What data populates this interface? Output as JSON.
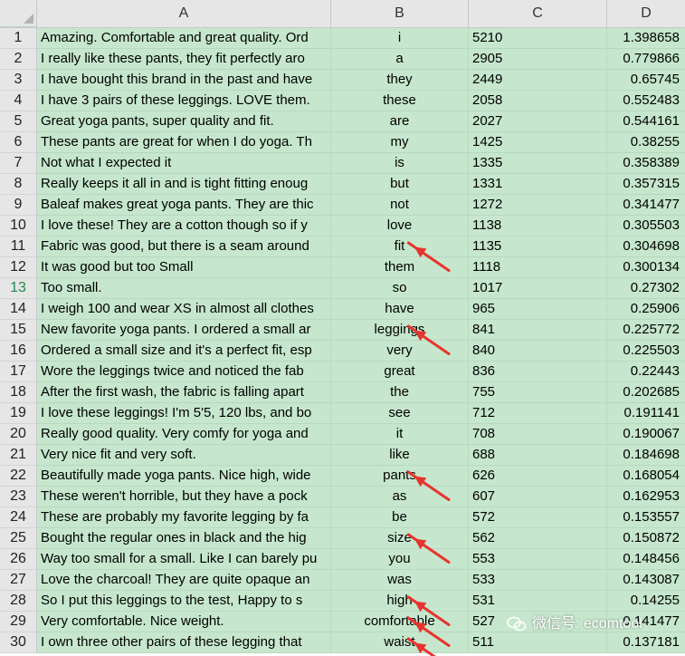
{
  "columns": [
    "A",
    "B",
    "C",
    "D"
  ],
  "selected_row": 13,
  "rows": [
    {
      "n": "1",
      "a": "Amazing. Comfortable and great quality. Ord",
      "b": "i",
      "c": "5210",
      "d": "1.398658"
    },
    {
      "n": "2",
      "a": "I really like these pants, they fit perfectly aro",
      "b": "a",
      "c": "2905",
      "d": "0.779866"
    },
    {
      "n": "3",
      "a": "I have bought this brand in the past and have",
      "b": "they",
      "c": "2449",
      "d": "0.65745"
    },
    {
      "n": "4",
      "a": "I have 3 pairs of these leggings. LOVE them.",
      "b": "these",
      "c": "2058",
      "d": "0.552483"
    },
    {
      "n": "5",
      "a": "Great yoga pants, super quality and fit.",
      "b": "are",
      "c": "2027",
      "d": "0.544161"
    },
    {
      "n": "6",
      "a": "These pants are great for when I do yoga. Th",
      "b": "my",
      "c": "1425",
      "d": "0.38255"
    },
    {
      "n": "7",
      "a": "Not what I expected it",
      "b": "is",
      "c": "1335",
      "d": "0.358389"
    },
    {
      "n": "8",
      "a": "Really keeps it all in and is tight fitting enoug",
      "b": "but",
      "c": "1331",
      "d": "0.357315"
    },
    {
      "n": "9",
      "a": "Baleaf makes great yoga pants. They are thic",
      "b": "not",
      "c": "1272",
      "d": "0.341477"
    },
    {
      "n": "10",
      "a": "I love these! They are a cotton though so if y",
      "b": "love",
      "c": "1138",
      "d": "0.305503"
    },
    {
      "n": "11",
      "a": "Fabric was good, but there is a seam around",
      "b": "fit",
      "c": "1135",
      "d": "0.304698"
    },
    {
      "n": "12",
      "a": "It was good but too Small",
      "b": "them",
      "c": "1118",
      "d": "0.300134"
    },
    {
      "n": "13",
      "a": "Too small.",
      "b": "so",
      "c": "1017",
      "d": "0.27302"
    },
    {
      "n": "14",
      "a": "I weigh 100 and wear XS in almost all clothes",
      "b": "have",
      "c": "965",
      "d": "0.25906"
    },
    {
      "n": "15",
      "a": "New favorite yoga pants. I ordered a small ar",
      "b": "leggings",
      "c": "841",
      "d": "0.225772"
    },
    {
      "n": "16",
      "a": "Ordered a small size and it's a perfect fit, esp",
      "b": "very",
      "c": "840",
      "d": "0.225503"
    },
    {
      "n": "17",
      "a": "Wore the leggings twice and noticed the fab",
      "b": "great",
      "c": "836",
      "d": "0.22443"
    },
    {
      "n": "18",
      "a": "After the first wash, the fabric is falling apart",
      "b": "the",
      "c": "755",
      "d": "0.202685"
    },
    {
      "n": "19",
      "a": "I love these leggings! I'm 5'5, 120 lbs, and bo",
      "b": "see",
      "c": "712",
      "d": "0.191141"
    },
    {
      "n": "20",
      "a": "Really good quality. Very comfy for yoga and",
      "b": "it",
      "c": "708",
      "d": "0.190067"
    },
    {
      "n": "21",
      "a": "Very nice fit and very soft.",
      "b": "like",
      "c": "688",
      "d": "0.184698"
    },
    {
      "n": "22",
      "a": "Beautifully made yoga pants. Nice high, wide",
      "b": "pants",
      "c": "626",
      "d": "0.168054"
    },
    {
      "n": "23",
      "a": "These weren't horrible, but they have a pock",
      "b": "as",
      "c": "607",
      "d": "0.162953"
    },
    {
      "n": "24",
      "a": "These are probably my favorite legging by fa",
      "b": "be",
      "c": "572",
      "d": "0.153557"
    },
    {
      "n": "25",
      "a": "Bought the regular ones in black and the hig",
      "b": "size",
      "c": "562",
      "d": "0.150872"
    },
    {
      "n": "26",
      "a": "Way too small for a small. Like I can barely pu",
      "b": "you",
      "c": "553",
      "d": "0.148456"
    },
    {
      "n": "27",
      "a": "Love the charcoal! They are quite opaque an",
      "b": "was",
      "c": "533",
      "d": "0.143087"
    },
    {
      "n": "28",
      "a": "So I put this leggings to the test, Happy to s",
      "b": "high",
      "c": "531",
      "d": "0.14255"
    },
    {
      "n": "29",
      "a": "Very comfortable. Nice weight.",
      "b": "comfortable",
      "c": "527",
      "d": "0.141477"
    },
    {
      "n": "30",
      "a": "I own three other pairs of these legging that",
      "b": "waist",
      "c": "511",
      "d": "0.137181"
    }
  ],
  "annotations": {
    "arrow_color": "#e8342e",
    "arrow_rows": [
      11,
      15,
      22,
      25,
      28,
      29,
      30
    ]
  },
  "watermark": {
    "label": "微信号: ecomtool",
    "icon": "wechat-icon"
  }
}
